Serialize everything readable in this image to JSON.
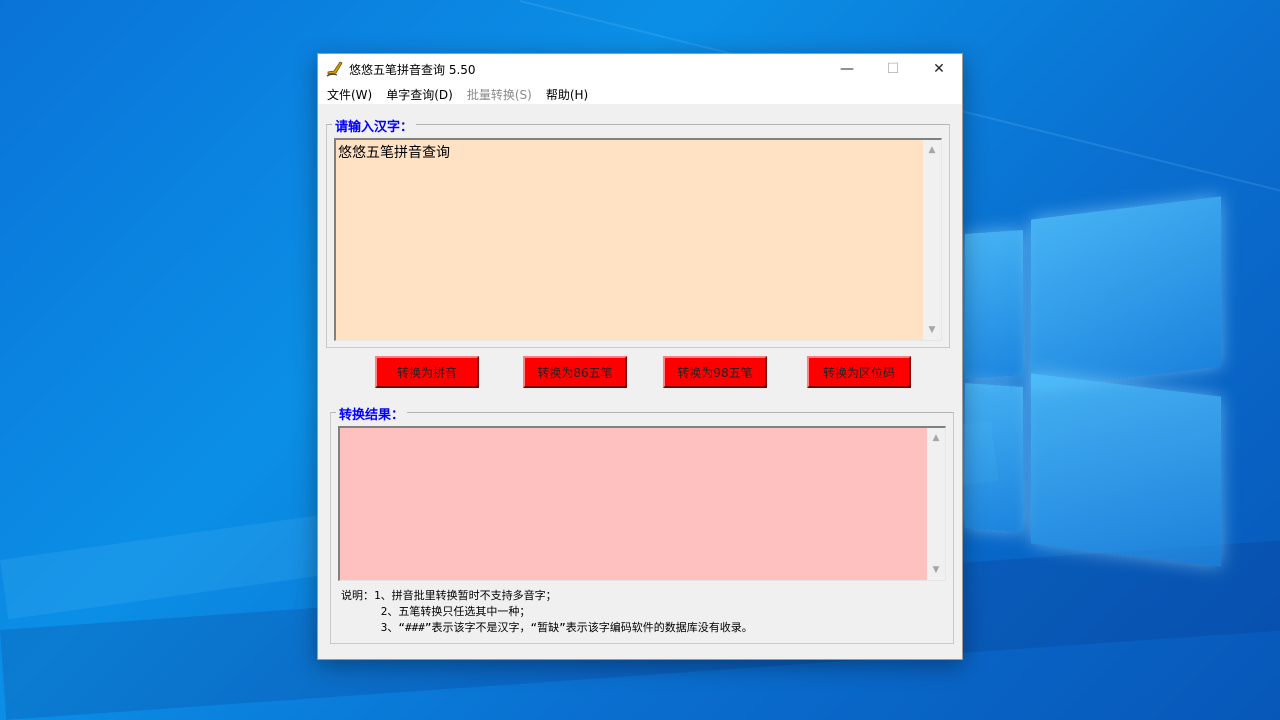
{
  "window": {
    "title": "悠悠五笔拼音查询 5.50",
    "controls": {
      "minimize": "—",
      "maximize": "☐",
      "close": "✕"
    }
  },
  "menu": [
    {
      "label": "文件(W)",
      "enabled": true
    },
    {
      "label": "单字查询(D)",
      "enabled": true
    },
    {
      "label": "批量转换(S)",
      "enabled": false
    },
    {
      "label": "帮助(H)",
      "enabled": true
    }
  ],
  "input_group": {
    "legend": "请输入汉字：",
    "value": "悠悠五笔拼音查询",
    "bg_color": "#ffe2c4"
  },
  "buttons": [
    {
      "label": "转换为拼音"
    },
    {
      "label": "转换为86五笔"
    },
    {
      "label": "转换为98五笔"
    },
    {
      "label": "转换为区位码"
    }
  ],
  "result_group": {
    "legend": "转换结果：",
    "value": "",
    "bg_color": "#ffc0c0"
  },
  "notes": {
    "line1": "说明：1、拼音批里转换暂时不支持多音字；",
    "line2": "      2、五笔转换只任选其中一种；",
    "line3": "      3、“###”表示该字不是汉字，“暂缺”表示该字编码软件的数据库没有收录。"
  },
  "colors": {
    "accent_legend": "#0000ff",
    "button_red": "#ff0000"
  }
}
